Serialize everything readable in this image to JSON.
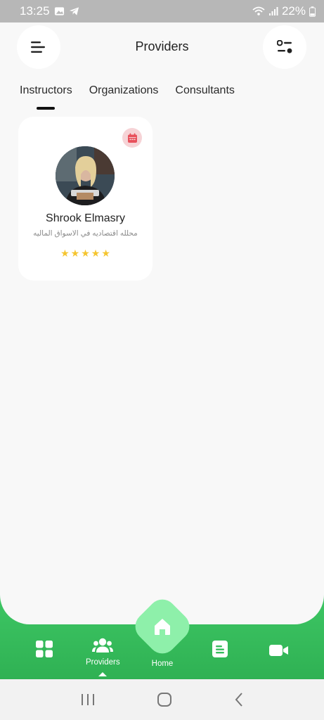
{
  "status_bar": {
    "time": "13:25",
    "battery": "22%"
  },
  "header": {
    "title": "Providers",
    "menu_icon": "menu-icon",
    "filter_icon": "filter-icon"
  },
  "tabs": [
    {
      "label": "Instructors",
      "active": true
    },
    {
      "label": "Organizations",
      "active": false
    },
    {
      "label": "Consultants",
      "active": false
    }
  ],
  "providers": [
    {
      "name": "Shrook Elmasry",
      "subtitle": "محلله اقتصاديه في الاسواق الماليه",
      "rating_stars": 5,
      "rating_max": 5,
      "badge_icon": "calendar-icon"
    }
  ],
  "bottom_nav": {
    "items": [
      {
        "icon": "grid-icon",
        "label": ""
      },
      {
        "icon": "users-icon",
        "label": "Providers",
        "active": true
      },
      {
        "icon": "home-icon",
        "label": "Home"
      },
      {
        "icon": "document-icon",
        "label": ""
      },
      {
        "icon": "video-icon",
        "label": ""
      }
    ]
  },
  "colors": {
    "accent_green": "#35bd5c",
    "home_fab": "#8ef0aa",
    "star": "#f5c52f",
    "calendar_badge": "#f6d3d6",
    "calendar_icon": "#e8505b"
  }
}
